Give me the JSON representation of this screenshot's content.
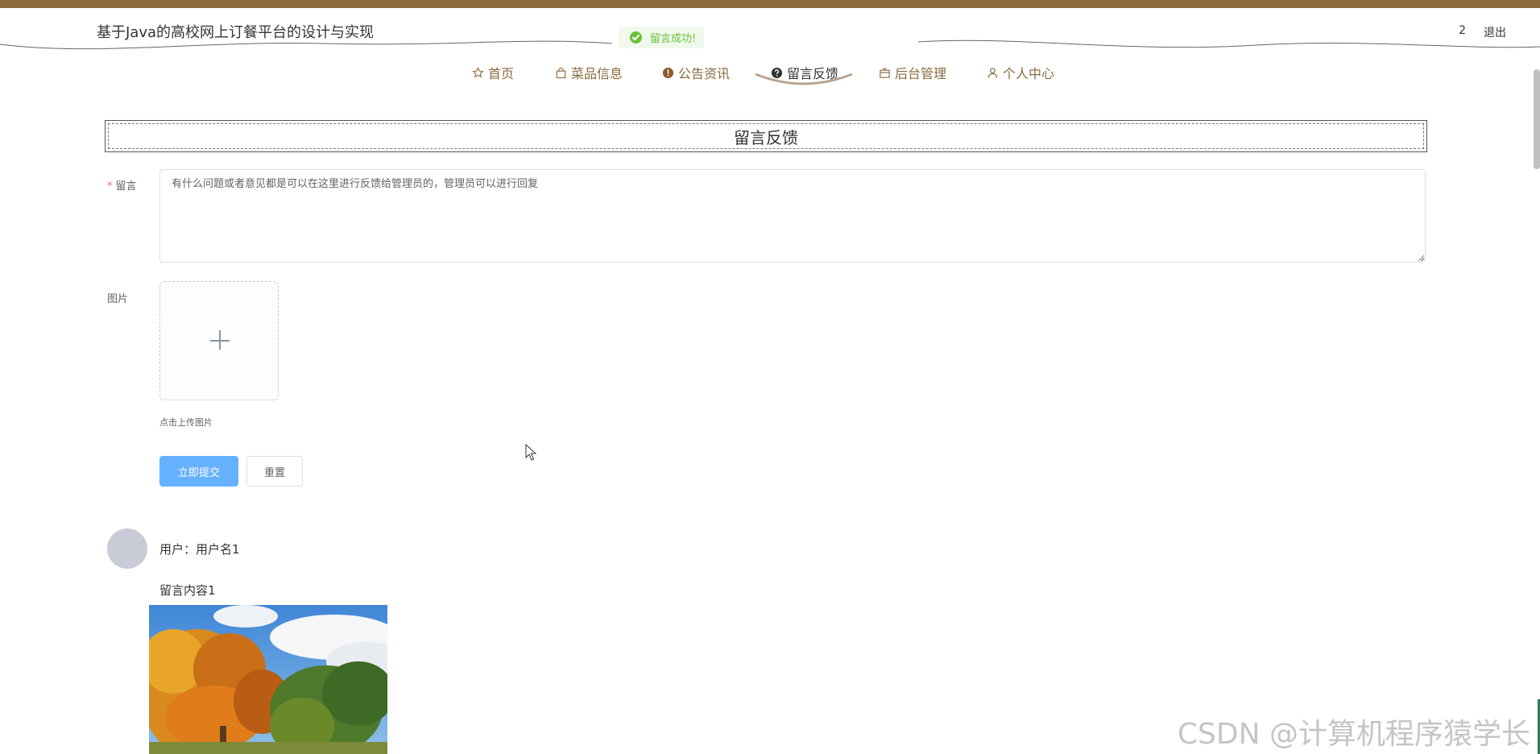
{
  "header": {
    "site_title": "基于Java的高校网上订餐平台的设计与实现",
    "user_number": "2",
    "logout_label": "退出"
  },
  "toast": {
    "message": "留言成功!",
    "color": "#67c23a"
  },
  "nav": {
    "active": "留言反馈",
    "items": [
      {
        "label": "首页",
        "icon": "star-icon"
      },
      {
        "label": "菜品信息",
        "icon": "bag-icon"
      },
      {
        "label": "公告资讯",
        "icon": "alert-icon"
      },
      {
        "label": "留言反馈",
        "icon": "question-icon"
      },
      {
        "label": "后台管理",
        "icon": "box-icon"
      },
      {
        "label": "个人中心",
        "icon": "user-icon"
      }
    ],
    "color": "#8b6a3e"
  },
  "panel": {
    "title": "留言反馈"
  },
  "form": {
    "message_label": "留言",
    "message_value": "有什么问题或者意见都是可以在这里进行反馈给管理员的，管理员可以进行回复",
    "image_label": "图片",
    "upload_tip": "点击上传图片",
    "submit_label": "立即提交",
    "reset_label": "重置"
  },
  "messages": [
    {
      "user": "用户：用户名1",
      "content": "留言内容1"
    }
  ],
  "watermark": "CSDN @计算机程序猿学长",
  "colors": {
    "brand_brown": "#8f6a3f",
    "primary_button": "#66b1ff"
  }
}
